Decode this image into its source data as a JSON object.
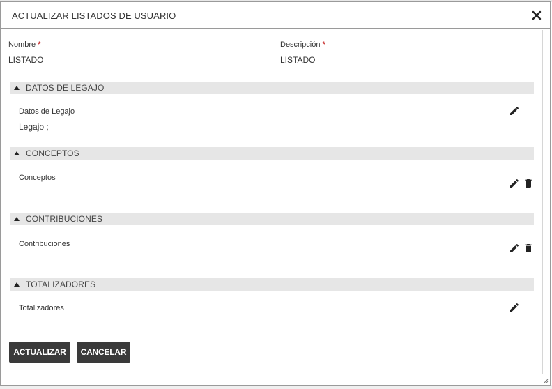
{
  "dialog": {
    "title": "ACTUALIZAR LISTADOS DE USUARIO"
  },
  "fields": {
    "nombre_label": "Nombre",
    "nombre_value": "LISTADO",
    "descripcion_label": "Descripción",
    "descripcion_value": "LISTADO",
    "required_mark": "*"
  },
  "sections": [
    {
      "title": "DATOS DE LEGAJO",
      "label": "Datos de Legajo",
      "value": "Legajo ;",
      "actions": [
        "edit-icon"
      ]
    },
    {
      "title": "CONCEPTOS",
      "label": "Conceptos",
      "value": "",
      "actions": [
        "edit-icon",
        "delete-icon"
      ]
    },
    {
      "title": "CONTRIBUCIONES",
      "label": "Contribuciones",
      "value": "",
      "actions": [
        "edit-icon",
        "delete-icon"
      ]
    },
    {
      "title": "TOTALIZADORES",
      "label": "Totalizadores",
      "value": "",
      "actions": [
        "edit-icon"
      ]
    }
  ],
  "buttons": {
    "update_label": "ACTUALIZAR",
    "cancel_label": "CANCELAR"
  },
  "colors": {
    "required": "#c62828",
    "section_bg": "#e6e6e6",
    "button_bg": "#3a3a3a"
  }
}
